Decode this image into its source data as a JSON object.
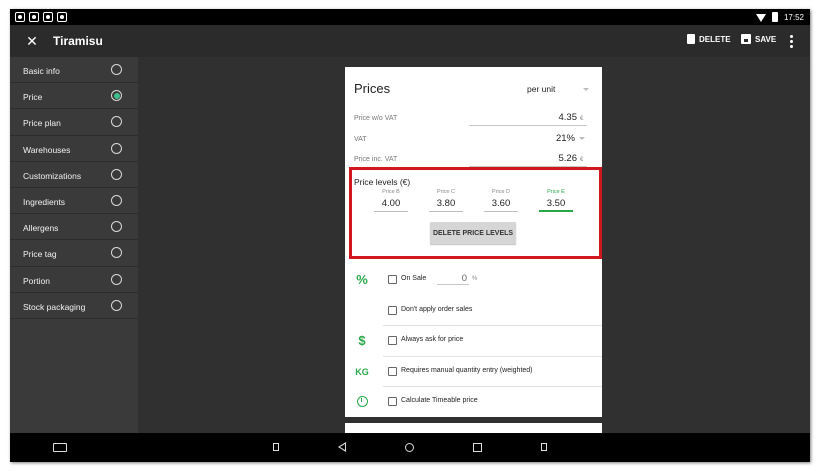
{
  "status_bar": {
    "time": "17:52"
  },
  "app_bar": {
    "title": "Tiramisu",
    "delete_label": "DELETE",
    "save_label": "SAVE"
  },
  "sidebar": {
    "items": [
      {
        "label": "Basic info",
        "selected": false
      },
      {
        "label": "Price",
        "selected": true
      },
      {
        "label": "Price plan",
        "selected": false
      },
      {
        "label": "Warehouses",
        "selected": false
      },
      {
        "label": "Customizations",
        "selected": false
      },
      {
        "label": "Ingredients",
        "selected": false
      },
      {
        "label": "Allergens",
        "selected": false
      },
      {
        "label": "Price tag",
        "selected": false
      },
      {
        "label": "Portion",
        "selected": false
      },
      {
        "label": "Stock packaging",
        "selected": false
      }
    ]
  },
  "prices": {
    "title": "Prices",
    "unit_select": "per unit",
    "price_wo_vat_label": "Price w/o VAT",
    "price_wo_vat_value": "4.35",
    "currency": "€",
    "vat_label": "VAT",
    "vat_value": "21%",
    "price_inc_vat_label": "Price inc. VAT",
    "price_inc_vat_value": "5.26"
  },
  "price_levels": {
    "title": "Price levels (€)",
    "levels": [
      {
        "label": "Price B",
        "value": "4.00"
      },
      {
        "label": "Price C",
        "value": "3.80"
      },
      {
        "label": "Price D",
        "value": "3.60"
      },
      {
        "label": "Price E",
        "value": "3.50"
      }
    ],
    "active_level": "Price E",
    "delete_button": "DELETE PRICE LEVELS"
  },
  "options": {
    "on_sale_label": "On Sale",
    "on_sale_value": "0",
    "on_sale_unit": "%",
    "dont_apply_label": "Don't apply order sales",
    "always_ask_label": "Always ask for price",
    "manual_qty_label": "Requires manual quantity entry (weighted)",
    "timeable_label": "Calculate Timeable price",
    "icons": {
      "sale": "percent-icon",
      "ask": "dollar-icon",
      "weight": "kg-icon",
      "time": "clock-icon"
    },
    "kg_text": "KG"
  },
  "colors": {
    "accent": "#2aa84a",
    "highlight": "#d0171f",
    "radio_on": "#3fbf8f"
  }
}
